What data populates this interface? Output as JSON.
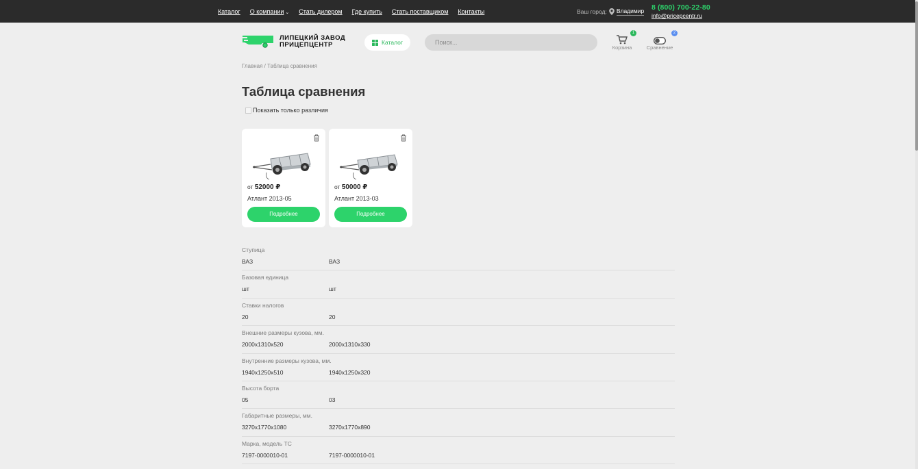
{
  "topbar": {
    "nav": [
      {
        "label": "Каталог"
      },
      {
        "label": "О компании",
        "dropdown": true
      },
      {
        "label": "Стать дилером"
      },
      {
        "label": "Где купить"
      },
      {
        "label": "Стать поставщиком"
      },
      {
        "label": "Контакты"
      }
    ],
    "city_label": "Ваш город:",
    "city": "Владимир",
    "phone": "8 (800) 700-22-80",
    "email": "info@pricepcentr.ru"
  },
  "header": {
    "logo_line1": "ЛИПЕЦКИЙ ЗАВОД",
    "logo_line2": "ПРИЦЕПЦЕНТР",
    "catalog_button": "Каталог",
    "search_placeholder": "Поиск...",
    "cart_label": "Корзина",
    "cart_count": "1",
    "compare_label": "Сравнение",
    "compare_count": "2"
  },
  "breadcrumb": "Главная / Таблица сравнения",
  "page_title": "Таблица сравнения",
  "diff_toggle_label": "Показать только различия",
  "products": [
    {
      "price_prefix": "от",
      "price": "52000 ₽",
      "name": "Атлант 2013-05",
      "button": "Подробнее"
    },
    {
      "price_prefix": "от",
      "price": "50000 ₽",
      "name": "Атлант 2013-03",
      "button": "Подробнее"
    }
  ],
  "specs": [
    {
      "label": "Ступица",
      "values": [
        "ВАЗ",
        "ВАЗ"
      ]
    },
    {
      "label": "Базовая единица",
      "values": [
        "шт",
        "шт"
      ]
    },
    {
      "label": "Ставки налогов",
      "values": [
        "20",
        "20"
      ]
    },
    {
      "label": "Внешние размеры кузова, мм.",
      "values": [
        "2000x1310x520",
        "2000x1310x330"
      ]
    },
    {
      "label": "Внутренние размеры кузова, мм.",
      "values": [
        "1940x1250x510",
        "1940x1250x320"
      ]
    },
    {
      "label": "Высота борта",
      "values": [
        "05",
        "03"
      ]
    },
    {
      "label": "Габаритные размеры, мм.",
      "values": [
        "3270x1770x1080",
        "3270x1770x890"
      ]
    },
    {
      "label": "Марка, модель ТС",
      "values": [
        "7197-0000010-01",
        "7197-0000010-01"
      ]
    }
  ],
  "colors": {
    "accent": "#2dd36b",
    "topbar": "#2b2b2b",
    "background": "#eeeeee"
  }
}
